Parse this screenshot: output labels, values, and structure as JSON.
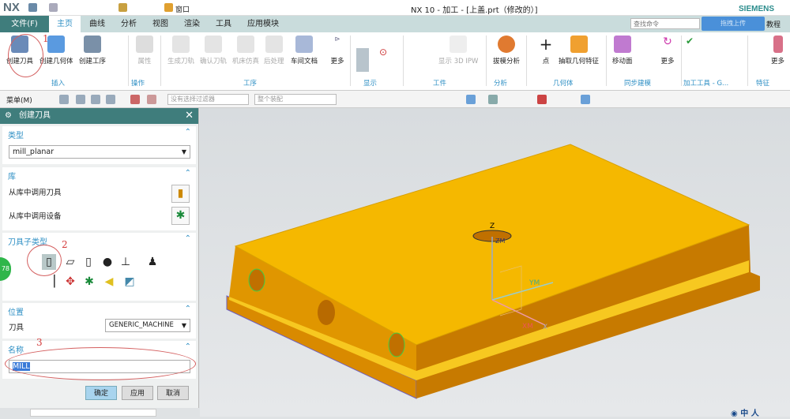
{
  "titlebar": {
    "logo": "NX",
    "title": "NX 10 - 加工 - [上盖.prt（修改的）]",
    "brand": "SIEMENS",
    "window_menu": "窗口"
  },
  "tabs": {
    "file": "文件(F)",
    "items": [
      "主页",
      "曲线",
      "分析",
      "视图",
      "渲染",
      "工具",
      "应用模块"
    ],
    "active": "主页"
  },
  "search": {
    "placeholder": "查找命令"
  },
  "upload_label": "拖拽上传",
  "tutorial_label": "教程",
  "ribbon": {
    "insert": {
      "buttons": [
        "创建刀具",
        "创建几何体",
        "创建工序"
      ],
      "group": "插入"
    },
    "operate": {
      "buttons": [
        "属性"
      ],
      "group": "操作"
    },
    "process": {
      "buttons": [
        "生成刀轨",
        "确认刀轨",
        "机床仿真",
        "后处理",
        "车间文档",
        "更多"
      ],
      "group": "工序"
    },
    "display": {
      "group": "显示"
    },
    "workpiece": {
      "buttons": [
        "显示 3D IPW"
      ],
      "group": "工件"
    },
    "analysis": {
      "buttons": [
        "拔模分析"
      ],
      "group": "分析"
    },
    "geometry": {
      "buttons": [
        "点",
        "抽取几何特征"
      ],
      "group": "几何体"
    },
    "sync": {
      "buttons": [
        "移动面",
        "更多"
      ],
      "group": "同步建模"
    },
    "mfgtools": {
      "group": "加工工具 - G..."
    },
    "feature": {
      "buttons": [
        "更多"
      ],
      "group": "特征"
    }
  },
  "toolbar2": {
    "menu": "菜单(M)",
    "filter": "没有选择过滤器",
    "scope": "整个装配"
  },
  "dialog": {
    "title": "创建刀具",
    "type": {
      "header": "类型",
      "value": "mill_planar"
    },
    "library": {
      "header": "库",
      "items": [
        "从库中调用刀具",
        "从库中调用设备"
      ]
    },
    "subtype": {
      "header": "刀具子类型"
    },
    "position": {
      "header": "位置",
      "label": "刀具",
      "value": "GENERIC_MACHINE"
    },
    "name": {
      "header": "名称",
      "value": "MILL"
    },
    "buttons": {
      "ok": "确定",
      "apply": "应用",
      "cancel": "取消"
    }
  },
  "annotations": [
    "1",
    "2",
    "3"
  ],
  "side_badge": "78",
  "axes": {
    "z": "Z",
    "zm": "ZM",
    "ym": "YM",
    "xm": "XM",
    "x": "X"
  },
  "colors": {
    "accent": "#3f7d7c",
    "part_top": "#f5b800",
    "part_side": "#e09000",
    "link": "#2e8fc4"
  }
}
